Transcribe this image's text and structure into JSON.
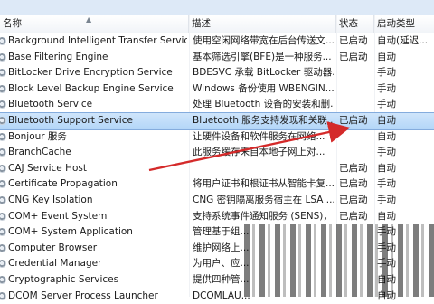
{
  "header": {
    "name": "名称",
    "description": "描述",
    "status": "状态",
    "startup_type": "启动类型"
  },
  "rows": [
    {
      "name": "Background Intelligent Transfer Service",
      "desc": "使用空闲网络带宽在后台传送文...",
      "status": "已启动",
      "start": "自动(延迟..."
    },
    {
      "name": "Base Filtering Engine",
      "desc": "基本筛选引擎(BFE)是一种服务...",
      "status": "已启动",
      "start": "自动"
    },
    {
      "name": "BitLocker Drive Encryption Service",
      "desc": "BDESVC 承载 BitLocker 驱动器...",
      "status": "",
      "start": "手动"
    },
    {
      "name": "Block Level Backup Engine Service",
      "desc": "Windows 备份使用 WBENGIN...",
      "status": "",
      "start": "手动"
    },
    {
      "name": "Bluetooth Service",
      "desc": "处理 Bluetooth 设备的安装和删...",
      "status": "",
      "start": "手动"
    },
    {
      "name": "Bluetooth Support Service",
      "desc": "Bluetooth 服务支持发现和关联...",
      "status": "已启动",
      "start": "自动"
    },
    {
      "name": "Bonjour 服务",
      "desc": "让硬件设备和软件服务在网络...",
      "status": "",
      "start": "自动"
    },
    {
      "name": "BranchCache",
      "desc": "此服务缓存来自本地子网上对...",
      "status": "",
      "start": "手动"
    },
    {
      "name": "CAJ Service Host",
      "desc": "",
      "status": "已启动",
      "start": "自动"
    },
    {
      "name": "Certificate Propagation",
      "desc": "将用户证书和根证书从智能卡复...",
      "status": "已启动",
      "start": "手动"
    },
    {
      "name": "CNG Key Isolation",
      "desc": "CNG 密钥隔离服务宿主在 LSA ...",
      "status": "已启动",
      "start": "手动"
    },
    {
      "name": "COM+ Event System",
      "desc": "支持系统事件通知服务 (SENS)，...",
      "status": "已启动",
      "start": "自动"
    },
    {
      "name": "COM+ System Application",
      "desc": "管理基于组...",
      "status": "",
      "start": "手动"
    },
    {
      "name": "Computer Browser",
      "desc": "维护网络上...",
      "status": "",
      "start": "手动"
    },
    {
      "name": "Credential Manager",
      "desc": "为用户、应...",
      "status": "",
      "start": "手动"
    },
    {
      "name": "Cryptographic Services",
      "desc": "提供四种管...",
      "status": "",
      "start": "自动"
    },
    {
      "name": "DCOM Server Process Launcher",
      "desc": "DCOMLAU...",
      "status": "",
      "start": "自动"
    }
  ],
  "selected_row_index": 5,
  "annotation": {
    "color": "#d42a2a"
  }
}
